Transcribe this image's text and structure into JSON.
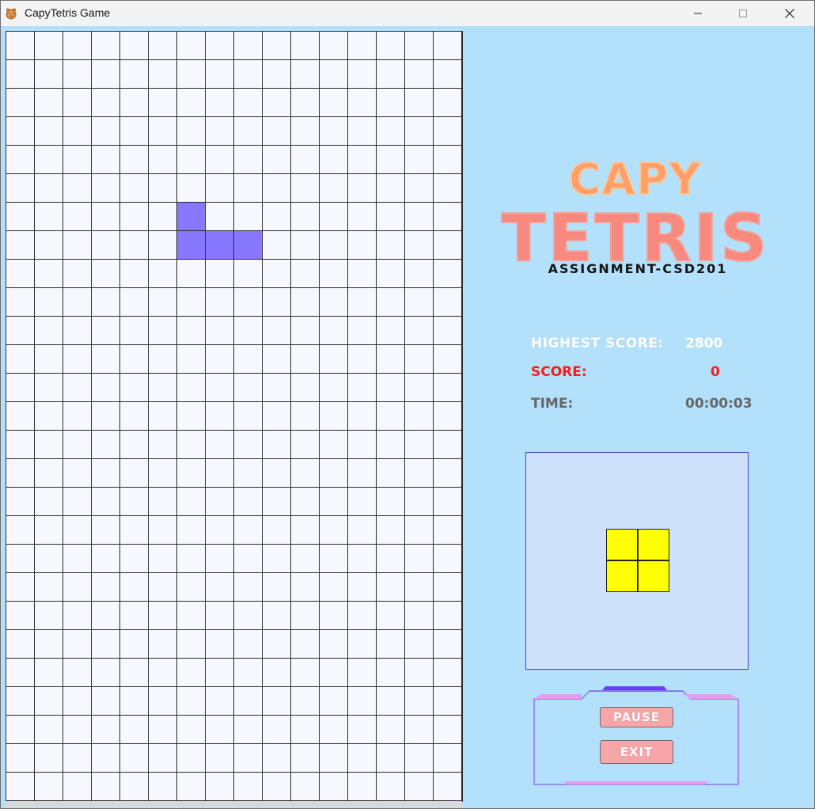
{
  "window": {
    "title": "CapyTetris Game",
    "minimize_icon": "minimize-icon",
    "maximize_icon": "maximize-icon",
    "close_icon": "close-icon"
  },
  "board": {
    "columns": 16,
    "rows": 27,
    "empty_color": "#f7f7ff",
    "grid_line_color": "#2b2b2b",
    "active_piece": {
      "color": "#8877ff",
      "cells": [
        [
          6,
          6
        ],
        [
          6,
          7
        ],
        [
          7,
          7
        ],
        [
          8,
          7
        ]
      ]
    }
  },
  "logo": {
    "line1": "CAPY",
    "line2": "TETRIS",
    "line1_color": "#ff9f6a",
    "line2_color": "#f7897e"
  },
  "subtitle": "ASSIGNMENT-CSD201",
  "stats": {
    "highest_score_label": "HIGHEST SCORE:",
    "highest_score_value": "2800",
    "score_label": "SCORE:",
    "score_value": "0",
    "time_label": "TIME:",
    "time_value": "00:00:03"
  },
  "next_piece": {
    "color": "#ffff00",
    "cells": [
      [
        0,
        0
      ],
      [
        1,
        0
      ],
      [
        0,
        1
      ],
      [
        1,
        1
      ]
    ]
  },
  "controls": {
    "pause_label": "PAUSE",
    "exit_label": "EXIT",
    "button_color": "#f6a5a9"
  }
}
